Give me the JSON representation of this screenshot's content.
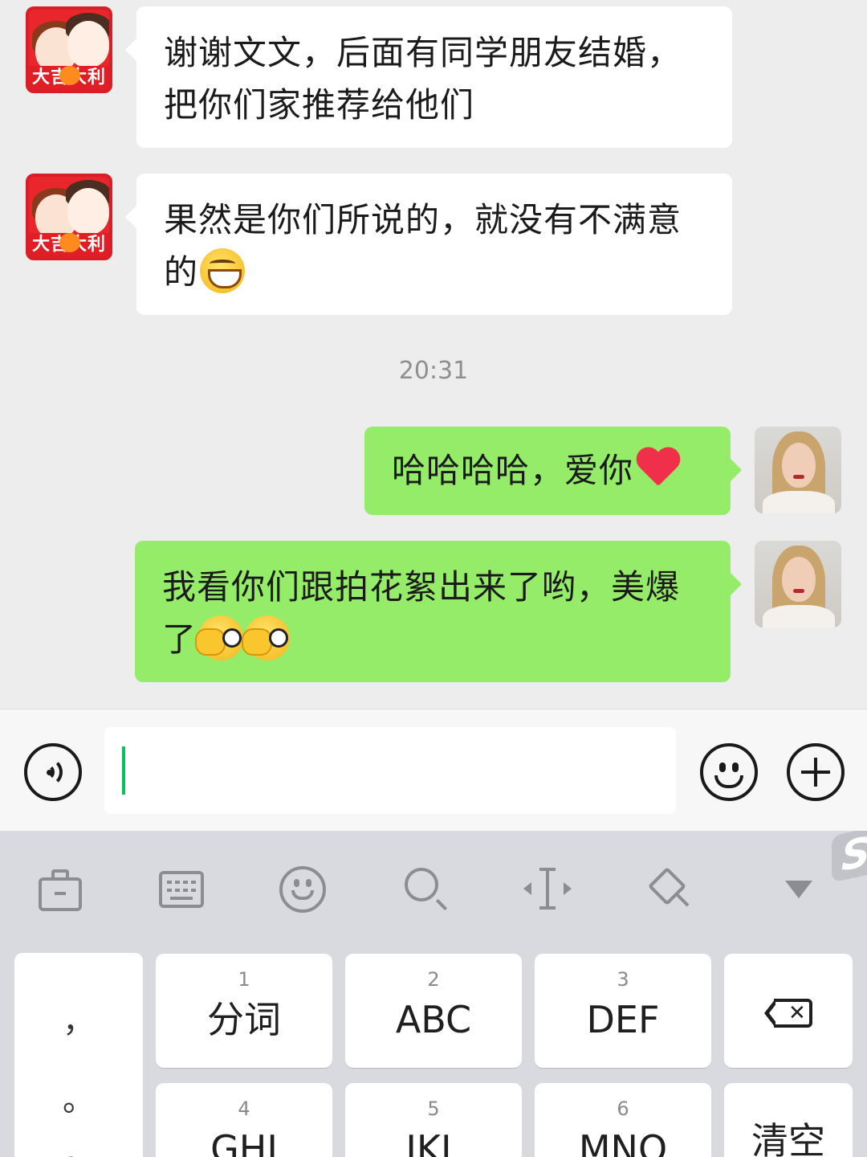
{
  "chat": {
    "messages": [
      {
        "direction": "in",
        "text": "谢谢文文，后面有同学朋友结婚，把你们家推荐给他们",
        "emoji": []
      },
      {
        "direction": "in",
        "text": "果然是你们所说的，就没有不满意的",
        "emoji": [
          "grin-emoji"
        ]
      },
      {
        "direction": "out",
        "text": "哈哈哈哈，爱你",
        "emoji": [
          "heart-emoji"
        ]
      },
      {
        "direction": "out",
        "text": "我看你们跟拍花絮出来了哟，美爆了",
        "emoji": [
          "peek-emoji",
          "peek-emoji"
        ]
      }
    ],
    "timestamp": "20:31",
    "contact_avatar_text": "大吉大利"
  },
  "input_bar": {
    "text_value": "",
    "icons": [
      "voice-icon",
      "emoji-icon",
      "plus-icon"
    ]
  },
  "keyboard": {
    "toolbar_icons": [
      "briefcase-icon",
      "keyboard-icon",
      "emoji-icon",
      "search-icon",
      "cursor-icon",
      "clear-format-icon",
      "collapse-icon"
    ],
    "badge": "S",
    "punctuation": [
      "，",
      "。",
      "？"
    ],
    "keys": [
      {
        "num": "1",
        "label": "分词"
      },
      {
        "num": "2",
        "label": "ABC"
      },
      {
        "num": "3",
        "label": "DEF"
      },
      {
        "num": "4",
        "label": "GHI"
      },
      {
        "num": "5",
        "label": "JKL"
      },
      {
        "num": "6",
        "label": "MNO"
      }
    ],
    "clear_label": "清空"
  },
  "colors": {
    "outgoing_bubble": "#95ec69",
    "incoming_bubble": "#ffffff",
    "chat_background": "#ededed",
    "caret": "#07c160",
    "keyboard_background": "#d9dadf"
  }
}
